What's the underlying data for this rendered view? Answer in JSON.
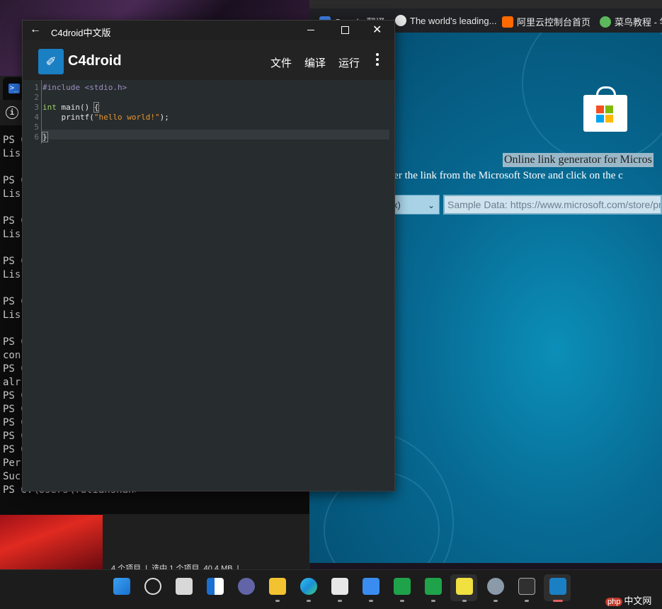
{
  "c4droid_window": {
    "title": "C4droid中文版",
    "app_name": "C4droid",
    "menu": {
      "file": "文件",
      "compile": "编译",
      "run": "运行"
    },
    "editor": {
      "line_numbers": [
        "1",
        "2",
        "3",
        "4",
        "5",
        "6"
      ],
      "code": {
        "line1": "#include <stdio.h>",
        "line3_kw": "int",
        "line3_rest": " main() ",
        "line3_brace": "{",
        "line4_pre": "    printf(",
        "line4_str": "\"hello world!\"",
        "line4_post": ");",
        "line6": "}"
      }
    }
  },
  "terminal": {
    "lines": [
      "PS C",
      "Lis",
      "",
      "PS C",
      "Lis",
      "",
      "PS C",
      "Lis",
      "",
      "PS C",
      "Lis",
      "",
      "PS C",
      "Lis",
      "",
      "PS C",
      "con",
      "PS C",
      "alr",
      "PS C",
      "PS C",
      "PS C",
      "PS C",
      "PS C",
      "Per",
      "Suc",
      "PS C:\\Users\\futianshan>"
    ]
  },
  "explorer": {
    "status": "4 个项目  |  选中 1 个项目  40.4 MB  |"
  },
  "browser": {
    "bookmarks": [
      {
        "label": "Google 翻译",
        "icon": "google-translate-icon",
        "color": "#4285f4"
      },
      {
        "label": "The world's leading...",
        "icon": "github-icon",
        "color": "#e8e8e8"
      },
      {
        "label": "阿里云控制台首页",
        "icon": "aliyun-icon",
        "color": "#ff6a00"
      },
      {
        "label": "菜鸟教程 - 学",
        "icon": "runoob-icon",
        "color": "#5cb85c"
      }
    ],
    "page": {
      "title": "Online link generator for Micros",
      "description": "ter the link from the Microsoft Store and click on the c",
      "select_value": "k)",
      "url_placeholder": "Sample Data: https://www.microsoft.com/store/pro"
    }
  },
  "taskbar": {
    "apps": [
      "start-icon",
      "search-icon",
      "task-view-icon",
      "widgets-icon",
      "teams-chat-icon",
      "file-explorer-icon",
      "edge-icon",
      "microsoft-store-icon",
      "feishu-icon",
      "green-app-icon",
      "green-app-icon-2",
      "update-shield-icon",
      "settings-icon",
      "terminal-icon",
      "c4droid-icon"
    ]
  },
  "watermark": {
    "badge": "php",
    "text": "中文网"
  },
  "colors": {
    "accent": "#1b7fc4",
    "keyword": "#9ccc65",
    "string": "#e69532",
    "preprocessor": "#9a8fbf"
  }
}
